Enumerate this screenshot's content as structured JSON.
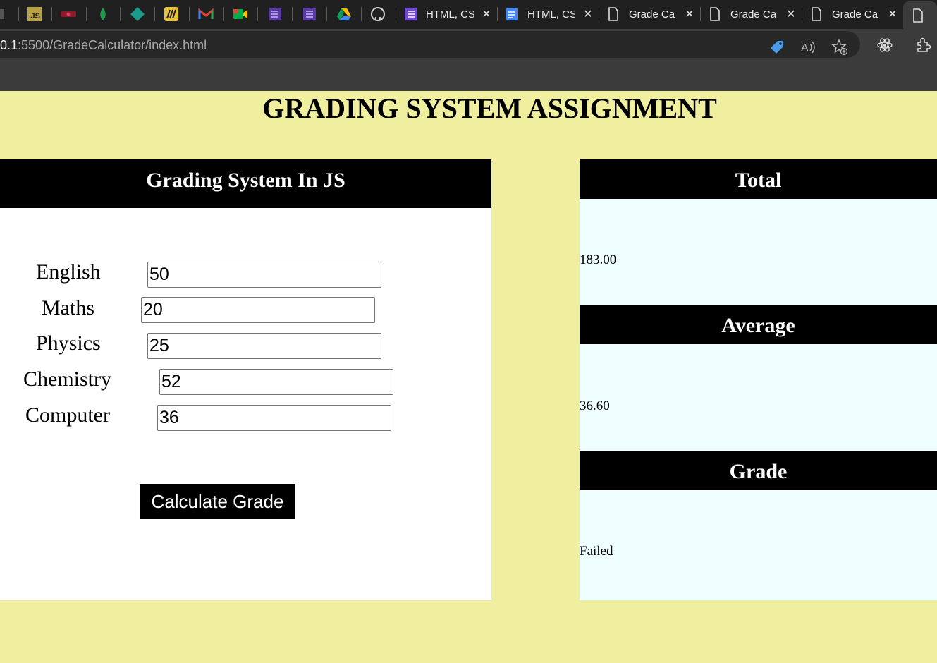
{
  "browser": {
    "tabs": [
      {
        "label": "HTML, CS",
        "icon": "forms-icon"
      },
      {
        "label": "HTML, CS",
        "icon": "docs-icon"
      },
      {
        "label": "Grade Ca",
        "icon": "page-icon"
      },
      {
        "label": "Grade Ca",
        "icon": "page-icon"
      },
      {
        "label": "Grade Ca",
        "icon": "page-icon"
      }
    ],
    "pinned_tab_js_text": "JS",
    "url_host": "0.1",
    "url_rest": ":5500/GradeCalculator/index.html",
    "colors": {
      "chrome_dark": "#202020",
      "chrome_mid": "#3b3b3b"
    }
  },
  "page": {
    "title": "GRADING SYSTEM ASSIGNMENT",
    "form": {
      "header": "Grading System In JS",
      "subjects": [
        {
          "label": "English",
          "value": "50"
        },
        {
          "label": "Maths",
          "value": "20"
        },
        {
          "label": "Physics",
          "value": "25"
        },
        {
          "label": "Chemistry",
          "value": "52"
        },
        {
          "label": "Computer",
          "value": "36"
        }
      ],
      "button_label": "Calculate Grade"
    },
    "results": {
      "total_header": "Total",
      "total_value": "183.00",
      "average_header": "Average",
      "average_value": "36.60",
      "grade_header": "Grade",
      "grade_value": "Failed"
    },
    "colors": {
      "background": "#f0ee9f",
      "panel": "#ffffff",
      "result_panel": "#efffff",
      "header": "#000000"
    }
  }
}
